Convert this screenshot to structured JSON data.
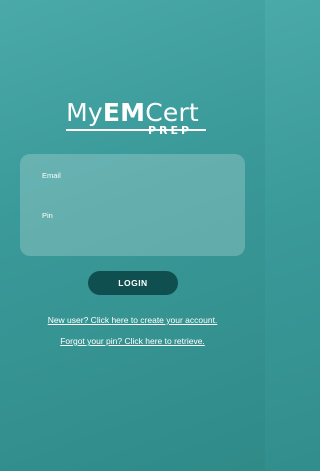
{
  "logo": {
    "my": "My",
    "em": "EM",
    "cert": "Cert",
    "prep": "PREP"
  },
  "form": {
    "email_label": "Email",
    "email_value": "",
    "pin_label": "Pin",
    "pin_value": ""
  },
  "buttons": {
    "login_label": "LOGIN"
  },
  "links": {
    "new_user": "New user? Click here to create your account.",
    "forgot_pin": "Forgot your pin? Click here to retrieve."
  },
  "colors": {
    "background_top": "#4aa9a9",
    "background_bottom": "#2f8a88",
    "button": "#0f4f50",
    "text": "#ffffff"
  }
}
